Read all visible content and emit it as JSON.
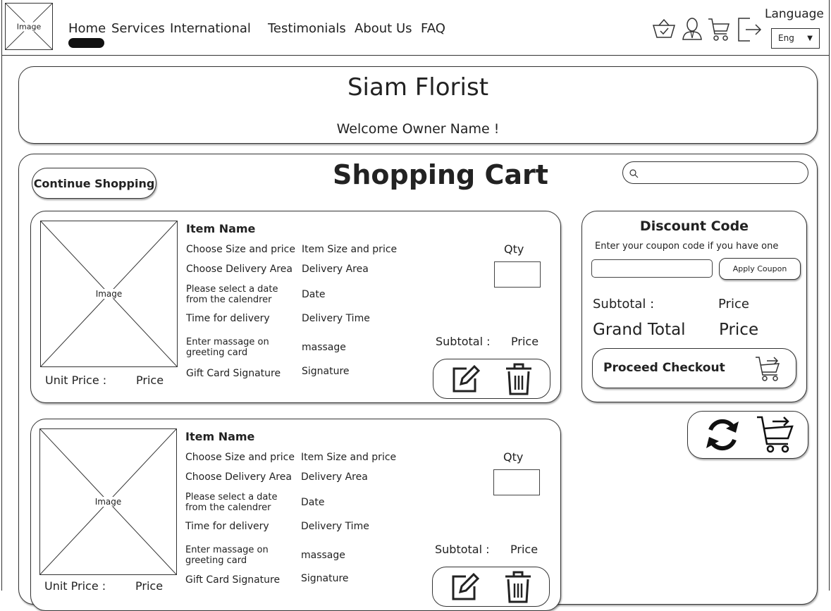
{
  "header": {
    "logo_label": "Image",
    "nav": [
      "Home",
      "Services",
      "International",
      "Testimonials",
      "About Us",
      "FAQ"
    ],
    "language_label": "Language",
    "language_value": "Eng",
    "icons": [
      "basket-check-icon",
      "user-icon",
      "cart-icon",
      "logout-icon"
    ]
  },
  "banner": {
    "title": "Siam Florist",
    "welcome": "Welcome Owner Name !"
  },
  "cart": {
    "title": "Shopping Cart",
    "continue_label": "Continue Shopping",
    "search_placeholder": ""
  },
  "item_labels": {
    "image": "Image",
    "name": "Item Name",
    "size_label": "Choose Size and price",
    "size_value": "Item Size and price",
    "area_label": "Choose Delivery Area",
    "area_value": "Delivery Area",
    "date_label": "Please select a date from the calendrer",
    "date_value": "Date",
    "time_label": "Time for delivery",
    "time_value": "Delivery Time",
    "message_label": "Enter massage on greeting card",
    "message_value": "massage",
    "signature_label": "Gift Card Signature",
    "signature_value": "Signature",
    "qty_label": "Qty",
    "subtotal_label": "Subtotal :",
    "subtotal_value": "Price",
    "unit_label": "Unit Price :",
    "unit_value": "Price"
  },
  "discount": {
    "title": "Discount Code",
    "hint": "Enter your coupon code if you have one",
    "apply_label": "Apply Coupon",
    "subtotal_label": "Subtotal :",
    "subtotal_value": "Price",
    "grand_label": "Grand Total",
    "grand_value": "Price",
    "checkout_label": "Proceed Checkout"
  }
}
